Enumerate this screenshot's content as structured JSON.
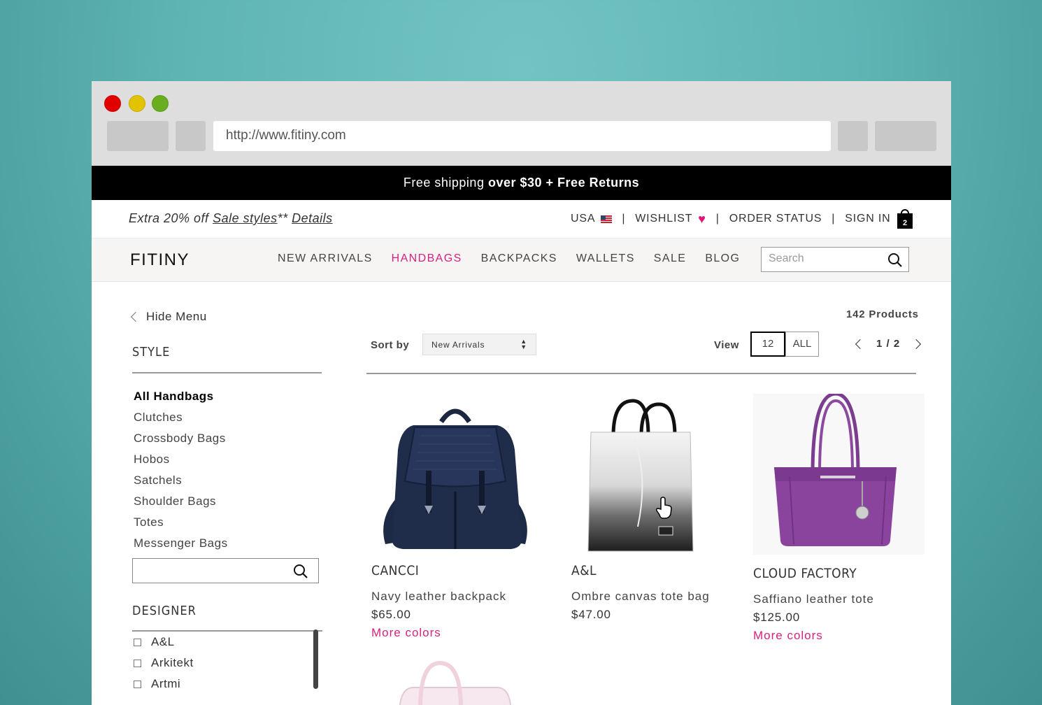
{
  "browser": {
    "url": "http://www.fitiny.com"
  },
  "promo": {
    "lead": "Free shipping",
    "bold": "over $30 + Free Returns"
  },
  "utility": {
    "extra_prefix": "Extra 20% off",
    "sale_link": "Sale styles",
    "asterisks": "**",
    "details_link": "Details",
    "country": "USA",
    "wishlist": "WISHLIST",
    "order_status": "ORDER STATUS",
    "sign_in": "SIGN IN",
    "cart_count": "2",
    "separator": "|"
  },
  "nav": {
    "logo": "FITINY",
    "items": [
      {
        "label": "NEW ARRIVALS"
      },
      {
        "label": "HANDBAGS"
      },
      {
        "label": "BACKPACKS"
      },
      {
        "label": "WALLETS"
      },
      {
        "label": "SALE"
      },
      {
        "label": "BLOG"
      }
    ],
    "search_placeholder": "Search"
  },
  "sidebar": {
    "hide_menu": "Hide Menu",
    "style_title": "STYLE",
    "styles": [
      "All Handbags",
      "Clutches",
      "Crossbody Bags",
      "Hobos",
      "Satchels",
      "Shoulder Bags",
      "Totes",
      "Messenger Bags"
    ],
    "designer_title": "DESIGNER",
    "designers": [
      "A&L",
      "Arkitekt",
      "Artmi"
    ]
  },
  "listing": {
    "count": "142 Products",
    "sort_label": "Sort by",
    "sort_value": "New Arrivals",
    "view_label": "View",
    "view_12": "12",
    "view_all": "ALL",
    "page": "1 / 2"
  },
  "products": [
    {
      "brand": "CANCCI",
      "name": "Navy leather backpack",
      "price": "$65.00",
      "more": "More colors"
    },
    {
      "brand": "A&L",
      "name": "Ombre canvas tote bag",
      "price": "$47.00",
      "more": ""
    },
    {
      "brand": "CLOUD FACTORY",
      "name": "Saffiano leather tote",
      "price": "$125.00",
      "more": "More colors"
    }
  ]
}
